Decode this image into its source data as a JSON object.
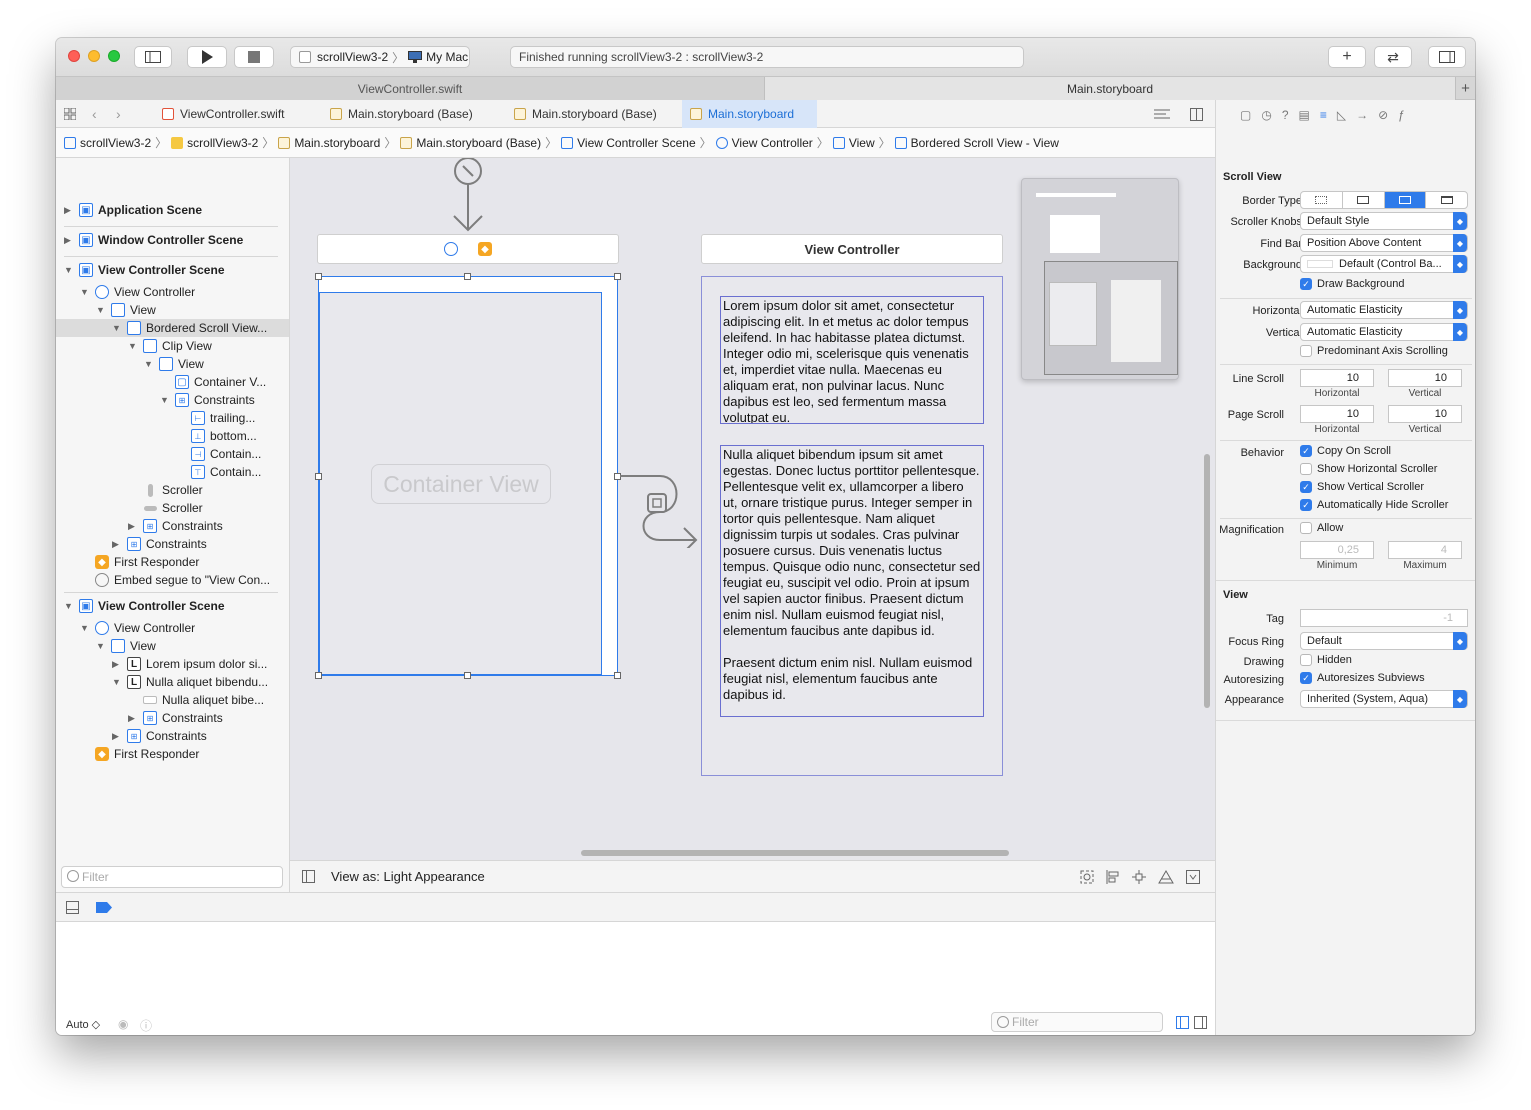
{
  "toolbar": {
    "scheme_target": "scrollView3-2",
    "scheme_device": "My Mac",
    "status": "Finished running scrollView3-2 : scrollView3-2",
    "add_label": "+",
    "swap_label": "⇄",
    "play_icon": "play-icon",
    "stop_icon": "stop-icon"
  },
  "window_tabs": [
    "ViewController.swift",
    "Main.storyboard"
  ],
  "window_tab_add": "+",
  "editor_tabs": [
    {
      "label": "ViewController.swift"
    },
    {
      "label": "Main.storyboard (Base)"
    },
    {
      "label": "Main.storyboard (Base)"
    },
    {
      "label": "Main.storyboard"
    }
  ],
  "breadcrumbs": [
    "scrollView3-2",
    "scrollView3-2",
    "Main.storyboard",
    "Main.storyboard (Base)",
    "View Controller Scene",
    "View Controller",
    "View",
    "Bordered Scroll View - View"
  ],
  "navigator": {
    "items": [
      "Application Scene",
      "Window Controller Scene",
      "View Controller Scene",
      "View Controller",
      "View",
      "Bordered Scroll View...",
      "Clip View",
      "View",
      "Container V...",
      "Constraints",
      "trailing...",
      "bottom...",
      "Contain...",
      "Contain...",
      "Scroller",
      "Scroller",
      "Constraints",
      "Constraints",
      "First Responder",
      "Embed segue to \"View Con...",
      "View Controller Scene",
      "View Controller",
      "View",
      "Lorem ipsum dolor si...",
      "Nulla aliquet bibendu...",
      "Nulla aliquet bibe...",
      "Constraints",
      "Constraints",
      "First Responder"
    ],
    "filter_placeholder": "Filter"
  },
  "canvas": {
    "container_view_label": "Container View",
    "view_controller_title": "View Controller",
    "text_block_1": "Lorem ipsum dolor sit amet, consectetur adipiscing elit. In et metus ac dolor tempus eleifend. In hac habitasse platea dictumst. Integer odio mi, scelerisque quis venenatis et, imperdiet vitae nulla. Maecenas eu aliquam erat, non pulvinar lacus. Nunc dapibus est leo, sed fermentum massa volutpat eu.",
    "text_block_2a": "Nulla aliquet bibendum ipsum sit amet egestas. Donec luctus porttitor pellentesque. Pellentesque velit ex, ullamcorper a libero ut, ornare tristique purus. Integer semper in tortor quis pellentesque. Nam aliquet dignissim turpis ut sodales. Cras pulvinar posuere cursus. Duis venenatis luctus tempus. Quisque odio nunc, consectetur sed feugiat eu, suscipit vel odio. Proin at ipsum vel sapien auctor finibus. Praesent dictum enim nisl. Nullam euismod feugiat nisl, elementum faucibus ante dapibus id.",
    "text_block_2b": "Praesent dictum enim nisl. Nullam euismod feugiat nisl, elementum faucibus ante dapibus id.",
    "view_as": "View as: Light Appearance"
  },
  "inspector": {
    "scroll_view_title": "Scroll View",
    "border_type_label": "Border Type",
    "scroller_knobs_label": "Scroller Knobs",
    "scroller_knobs_value": "Default Style",
    "find_bar_label": "Find Bar",
    "find_bar_value": "Position Above Content",
    "background_label": "Background",
    "background_value": "Default (Control Ba...",
    "draw_background": "Draw Background",
    "horizontal_label": "Horizontal",
    "horizontal_value": "Automatic Elasticity",
    "vertical_label": "Vertical",
    "vertical_value": "Automatic Elasticity",
    "predominant": "Predominant Axis Scrolling",
    "line_scroll_label": "Line Scroll",
    "line_scroll_h": "10",
    "line_scroll_v": "10",
    "page_scroll_label": "Page Scroll",
    "page_scroll_h": "10",
    "page_scroll_v": "10",
    "horizontal_sub": "Horizontal",
    "vertical_sub": "Vertical",
    "behavior_label": "Behavior",
    "copy_on_scroll": "Copy On Scroll",
    "show_h_scroller": "Show Horizontal Scroller",
    "show_v_scroller": "Show Vertical Scroller",
    "auto_hide": "Automatically Hide Scroller",
    "magnification_label": "Magnification",
    "allow": "Allow",
    "min_value": "0,25",
    "max_value": "4",
    "minimum_sub": "Minimum",
    "maximum_sub": "Maximum",
    "view_title": "View",
    "tag_label": "Tag",
    "tag_value": "-1",
    "focus_ring_label": "Focus Ring",
    "focus_ring_value": "Default",
    "drawing_label": "Drawing",
    "hidden": "Hidden",
    "autoresizing_label": "Autoresizing",
    "autoresizes": "Autoresizes Subviews",
    "appearance_label": "Appearance",
    "appearance_value": "Inherited (System, Aqua)"
  },
  "debug": {
    "auto_label": "Auto ◇",
    "filter_placeholder": "Filter"
  },
  "colors": {
    "accent": "#2f7bea",
    "orange": "#f5a623",
    "selected_tab": "#d7e5f9"
  }
}
